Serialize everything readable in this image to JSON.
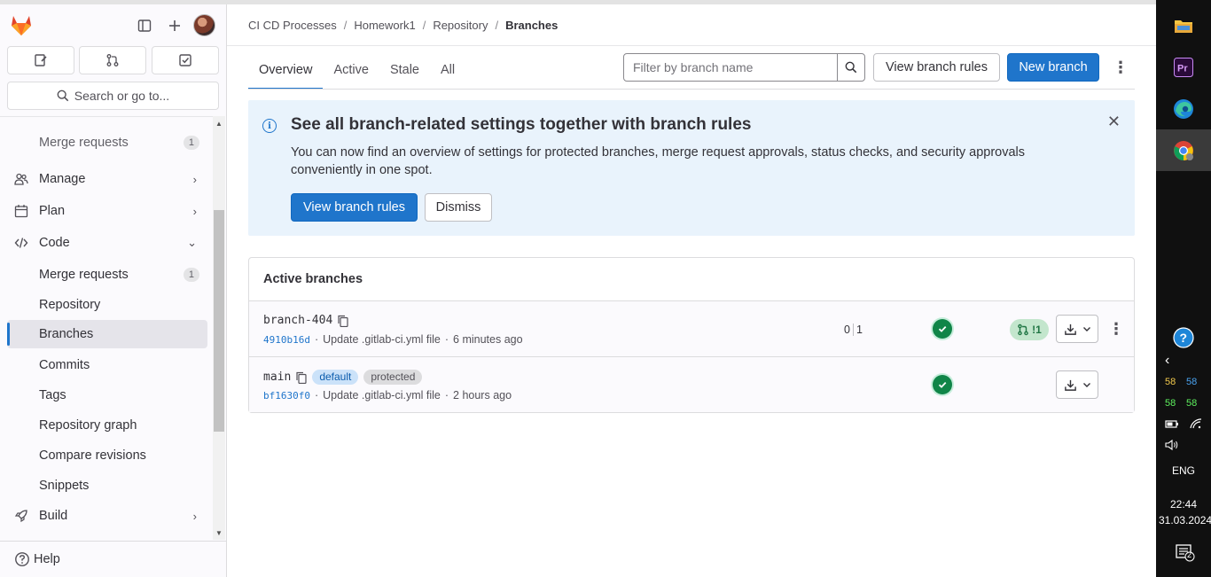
{
  "sidebar": {
    "search_label": "Search or go to...",
    "nav": {
      "merge_requests_top": {
        "label": "Merge requests",
        "count": "1"
      },
      "manage": "Manage",
      "plan": "Plan",
      "code": "Code",
      "merge_requests": {
        "label": "Merge requests",
        "count": "1"
      },
      "repository": "Repository",
      "branches": "Branches",
      "commits": "Commits",
      "tags": "Tags",
      "repository_graph": "Repository graph",
      "compare_revisions": "Compare revisions",
      "snippets": "Snippets",
      "build": "Build"
    },
    "help_label": "Help"
  },
  "breadcrumb": [
    "CI CD Processes",
    "Homework1",
    "Repository",
    "Branches"
  ],
  "tabs": [
    "Overview",
    "Active",
    "Stale",
    "All"
  ],
  "filter": {
    "placeholder": "Filter by branch name"
  },
  "toolbar": {
    "view_rules_label": "View branch rules",
    "new_branch_label": "New branch"
  },
  "alert": {
    "title": "See all branch-related settings together with branch rules",
    "body": "You can now find an overview of settings for protected branches, merge request approvals, status checks, and security approvals conveniently in one spot.",
    "primary_label": "View branch rules",
    "dismiss_label": "Dismiss"
  },
  "branches_card": {
    "title": "Active branches",
    "rows": [
      {
        "name": "branch-404",
        "sha": "4910b16d",
        "message": "Update .gitlab-ci.yml file",
        "time": "6 minutes ago",
        "behind": "0",
        "ahead": "1",
        "pipeline_status": "passed",
        "mr_count": "!1"
      },
      {
        "name": "main",
        "badges": [
          "default",
          "protected"
        ],
        "sha": "bf1630f0",
        "message": "Update .gitlab-ci.yml file",
        "time": "2 hours ago",
        "pipeline_status": "passed"
      }
    ]
  },
  "taskbar": {
    "temps": [
      "58",
      "58",
      "58",
      "58"
    ],
    "lang": "ENG",
    "time": "22:44",
    "date": "31.03.2024",
    "notifications": "2"
  },
  "colors": {
    "accent": "#1f75cb",
    "success": "#108548",
    "alert_bg": "#e9f3fc"
  }
}
